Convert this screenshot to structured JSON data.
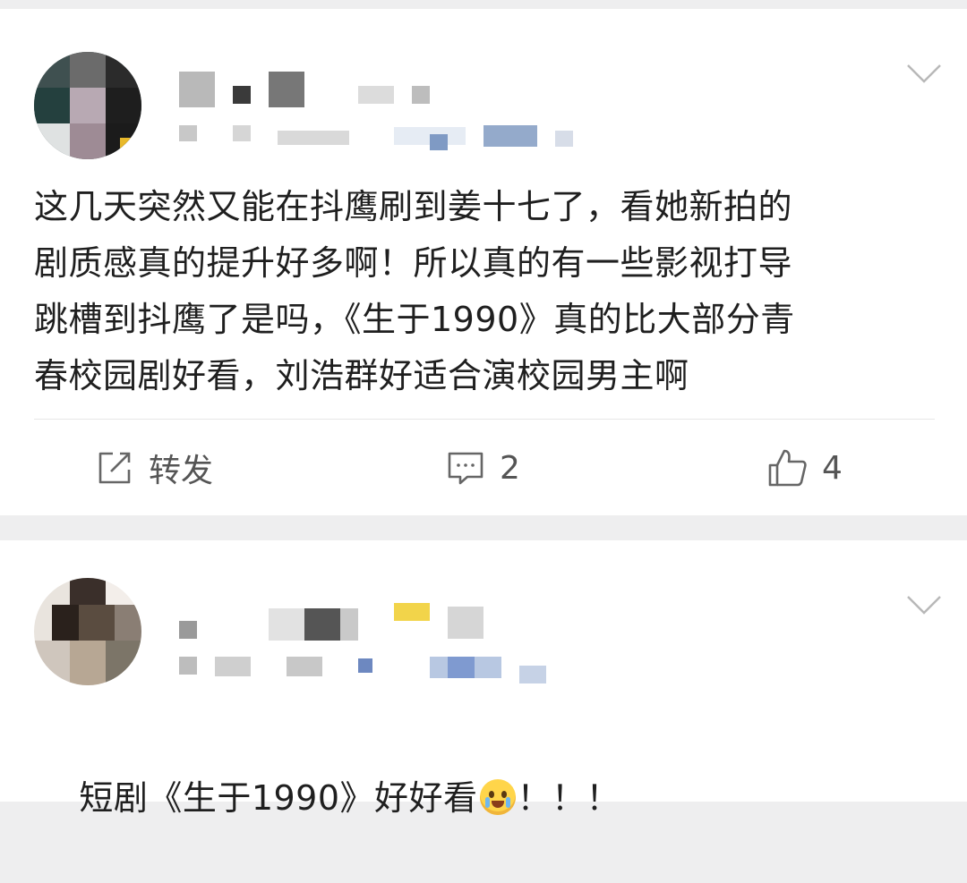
{
  "posts": [
    {
      "text": "这几天突然又能在抖鹰刷到姜十七了，看她新拍的\n剧质感真的提升好多啊！所以真的有一些影视打导\n跳槽到抖鹰了是吗，《生于1990》真的比大部分青\n春校园剧好看，刘浩群好适合演校园男主啊",
      "actions": {
        "repost_label": "转发",
        "comment_count": "2",
        "like_count": "4"
      }
    },
    {
      "text": "短剧《生于1990》好好看",
      "emoji_name": "crying-smiling-face",
      "trailing_text": "！！！"
    }
  ],
  "icons": {
    "repost": "share-edit-icon",
    "comment": "comment-bubble-icon",
    "like": "thumbs-up-icon",
    "more": "chevron-down-icon"
  },
  "colors": {
    "background": "#eeeeef",
    "card": "#ffffff",
    "text": "#1f1f1f",
    "action": "#555555"
  }
}
